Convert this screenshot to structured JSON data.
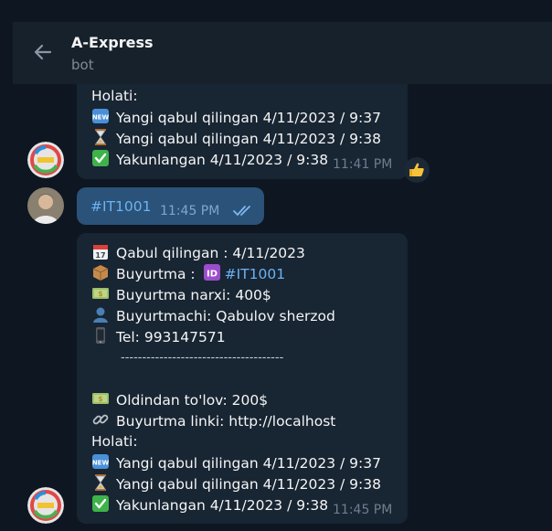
{
  "header": {
    "title": "A-Express",
    "subtitle": "bot"
  },
  "msg1": {
    "status_label": "Holati:",
    "status_new": "Yangi qabul qilingan 4/11/2023 / 9:37",
    "status_pending": "Yangi qabul qilingan 4/11/2023 / 9:38",
    "status_done": "Yakunlangan 4/11/2023 / 9:38",
    "time": "11:41 PM",
    "reaction": "thumbs-up"
  },
  "msg2": {
    "text": "#IT1001",
    "time": "11:45 PM"
  },
  "msg3": {
    "received": "Qabul qilingan : 4/11/2023",
    "order_label": "Buyurtma :",
    "order_id": "#IT1001",
    "price": "Buyurtma narxi: 400$",
    "customer": "Buyurtmachi: Qabulov sherzod",
    "phone": "Tel: 993147571",
    "separator": "--------------------------------------",
    "prepay": "Oldindan to'lov: 200$",
    "link": "Buyurtma linki:  http://localhost",
    "status_label": "Holati:",
    "status_new": "Yangi qabul qilingan 4/11/2023 / 9:37",
    "status_pending": "Yangi qabul qilingan 4/11/2023 / 9:38",
    "status_done": "Yakunlangan 4/11/2023 / 9:38",
    "time": "11:45 PM"
  },
  "icons": [
    "back-arrow-icon",
    "new-icon",
    "hourglass-icon",
    "check-icon",
    "calendar-icon",
    "package-icon",
    "id-icon",
    "money-icon",
    "user-icon",
    "phone-icon",
    "link-icon",
    "double-check-icon",
    "thumbs-up-icon"
  ],
  "colors": {
    "background": "#0e1621",
    "header": "#17212b",
    "incoming": "#182533",
    "outgoing": "#2b5278",
    "link": "#6ab3f3"
  }
}
